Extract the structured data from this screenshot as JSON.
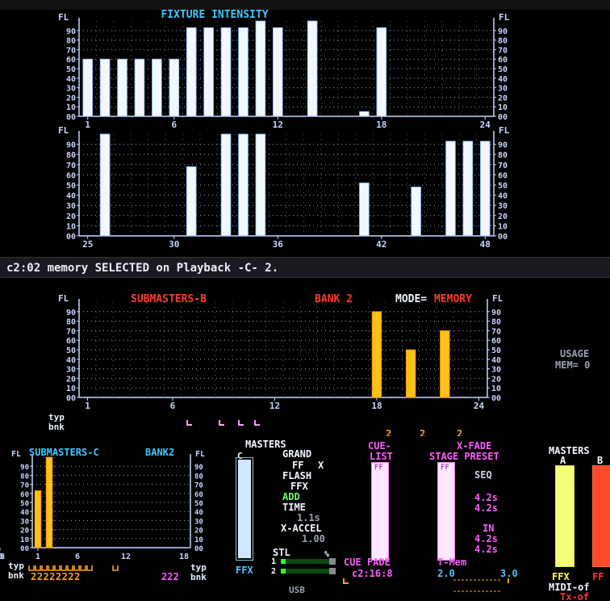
{
  "colors": {
    "bar_white": "#f2f8ff",
    "bar_yellow": "#ffc21a",
    "grid": "#9aa6c8",
    "axis": "#c8d4ff",
    "title_cyan": "#3fc8ff",
    "title_red": "#ff3a2a",
    "magenta": "#ff5cff",
    "orange": "#ffa020"
  },
  "fixture_panel": {
    "title": "FIXTURE INTENSITY",
    "unit": "FL",
    "y_ticks": [
      "90",
      "80",
      "70",
      "60",
      "50",
      "40",
      "30",
      "20",
      "10",
      "00"
    ]
  },
  "chart_data": [
    {
      "type": "bar",
      "title": "FIXTURE INTENSITY",
      "ylabel": "FL",
      "ylim": [
        0,
        100
      ],
      "x_tick_labels": [
        "1",
        "6",
        "12",
        "18",
        "24"
      ],
      "categories": [
        "1",
        "2",
        "3",
        "4",
        "5",
        "6",
        "7",
        "8",
        "9",
        "10",
        "11",
        "12",
        "13",
        "14",
        "15",
        "16",
        "17",
        "18",
        "19",
        "20",
        "21",
        "22",
        "23",
        "24"
      ],
      "values": [
        60,
        60,
        60,
        60,
        60,
        60,
        93,
        93,
        93,
        93,
        100,
        93,
        0,
        100,
        0,
        0,
        5,
        93,
        0,
        0,
        0,
        0,
        0,
        0
      ]
    },
    {
      "type": "bar",
      "ylabel": "FL",
      "ylim": [
        0,
        100
      ],
      "x_tick_labels": [
        "25",
        "30",
        "36",
        "42",
        "48"
      ],
      "categories": [
        "25",
        "26",
        "27",
        "28",
        "29",
        "30",
        "31",
        "32",
        "33",
        "34",
        "35",
        "36",
        "37",
        "38",
        "39",
        "40",
        "41",
        "42",
        "43",
        "44",
        "45",
        "46",
        "47",
        "48"
      ],
      "values": [
        0,
        100,
        0,
        0,
        0,
        0,
        68,
        0,
        100,
        100,
        100,
        0,
        0,
        0,
        0,
        0,
        52,
        0,
        0,
        48,
        0,
        93,
        93,
        93
      ]
    },
    {
      "type": "bar",
      "title": "SUBMASTERS-B",
      "ylabel": "FL",
      "ylim": [
        0,
        100
      ],
      "x_tick_labels": [
        "1",
        "6",
        "12",
        "18",
        "24"
      ],
      "categories": [
        "1",
        "2",
        "3",
        "4",
        "5",
        "6",
        "7",
        "8",
        "9",
        "10",
        "11",
        "12",
        "13",
        "14",
        "15",
        "16",
        "17",
        "18",
        "19",
        "20",
        "21",
        "22",
        "23",
        "24"
      ],
      "values": [
        0,
        0,
        0,
        0,
        0,
        0,
        0,
        0,
        0,
        0,
        0,
        0,
        0,
        0,
        0,
        0,
        0,
        90,
        0,
        50,
        0,
        70,
        0,
        0
      ]
    },
    {
      "type": "bar",
      "title": "SUBMASTERS-C BANK 2",
      "ylabel": "FL",
      "ylim": [
        0,
        100
      ],
      "x_tick_labels": [
        "1",
        "6",
        "12",
        "18"
      ],
      "categories": [
        "1",
        "2"
      ],
      "values": [
        63,
        100
      ]
    }
  ],
  "status_line": "c2:02 memory SELECTED on Playback -C- 2.",
  "subB_panel": {
    "title": "SUBMASTERS-B",
    "bank": "BANK 2",
    "mode_label": "MODE=",
    "mode_value": "MEMORY",
    "typ": "typ",
    "bnk": "bnk",
    "marks": [
      "2",
      "2",
      "2"
    ]
  },
  "usage": {
    "label": "USAGE",
    "mem": "MEM= 0"
  },
  "subC_panel": {
    "title": "SUBMASTERS-C",
    "bank": "BANK2",
    "typ": "typ",
    "bnk": "bnk",
    "bank_digits": "22222222",
    "right_digits": "222",
    "x_ticks": [
      "1",
      "6",
      "12",
      "18"
    ]
  },
  "masters_panel": {
    "title": "MASTERS",
    "column": "C",
    "lines": [
      "GRAND",
      "FF",
      "X",
      "FLASH",
      "FFX",
      "ADD",
      "TIME",
      "1.1s",
      "X-ACCEL",
      "1.00"
    ],
    "ffx": "FFX",
    "stl": "STL",
    "percent": "%",
    "usb": "USB"
  },
  "cuelist": {
    "title1": "CUE-",
    "title2": "LIST",
    "ff": "FF"
  },
  "xfade": {
    "title1": "X-FADE",
    "title2": "STAGE PRESET",
    "seq": "SEQ",
    "times": [
      "4.2s",
      "4.2s"
    ],
    "in": "IN",
    "in_times": [
      "4.2s",
      "4.2s"
    ],
    "ff": "FF"
  },
  "bottom_right": {
    "cue_fade": "CUE FADE",
    "cue_val": "c2:16:8",
    "t_mem": "T-Mem",
    "val1": "2.0",
    "val2": "3.0"
  },
  "masters_ab": {
    "title": "MASTERS",
    "a": "A",
    "b": "B",
    "ffx": "FFX",
    "ff": "FF",
    "midi": "MIDI-of",
    "tx": "Tx-of"
  }
}
